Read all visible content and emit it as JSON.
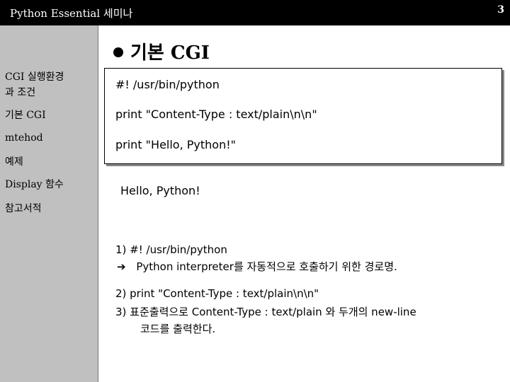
{
  "header": {
    "title": "Python Essential 세미나",
    "page_number": "3"
  },
  "sidebar": {
    "items": [
      {
        "label": "CGI 실행환경"
      },
      {
        "label": "과 조건"
      },
      {
        "label": "기본 CGI"
      },
      {
        "label": "mtehod"
      },
      {
        "label": "예제"
      },
      {
        "label": "Display 함수"
      },
      {
        "label": "참고서적"
      }
    ]
  },
  "main": {
    "heading": "기본 CGI",
    "code_lines": [
      "#! /usr/bin/python",
      "print \"Content-Type : text/plain\\n\\n\"",
      "print \"Hello, Python!\""
    ],
    "output": "Hello, Python!",
    "notes": {
      "n1": "1)  #! /usr/bin/python",
      "n1_arrow": "➔",
      "n1_desc": "Python interpreter를 자동적으로 호출하기 위한 경로명.",
      "n2": "2)  print \"Content-Type : text/plain\\n\\n\"",
      "n3": "3)  표준출력으로 Content-Type : text/plain 와 두개의 new-line",
      "n3_cont": "코드를 출력한다."
    }
  }
}
